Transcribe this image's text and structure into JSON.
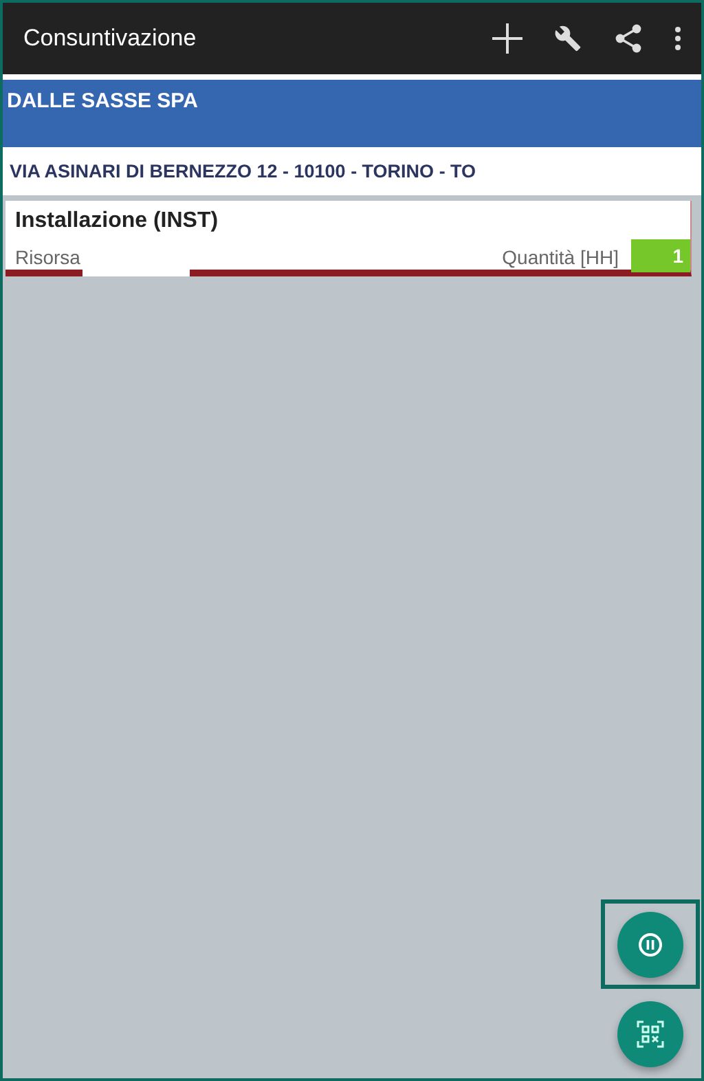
{
  "toolbar": {
    "title": "Consuntivazione"
  },
  "customer": {
    "name": "DALLE SASSE SPA",
    "address": "VIA ASINARI DI BERNEZZO 12 - 10100 - TORINO - TO"
  },
  "activity": {
    "title": "Installazione (INST)",
    "resource_label": "Risorsa",
    "quantity_label": "Quantità [HH]",
    "quantity": "1"
  },
  "fabs": [
    {
      "kind": "pause",
      "focused": true
    },
    {
      "kind": "scan",
      "focused": false
    }
  ]
}
